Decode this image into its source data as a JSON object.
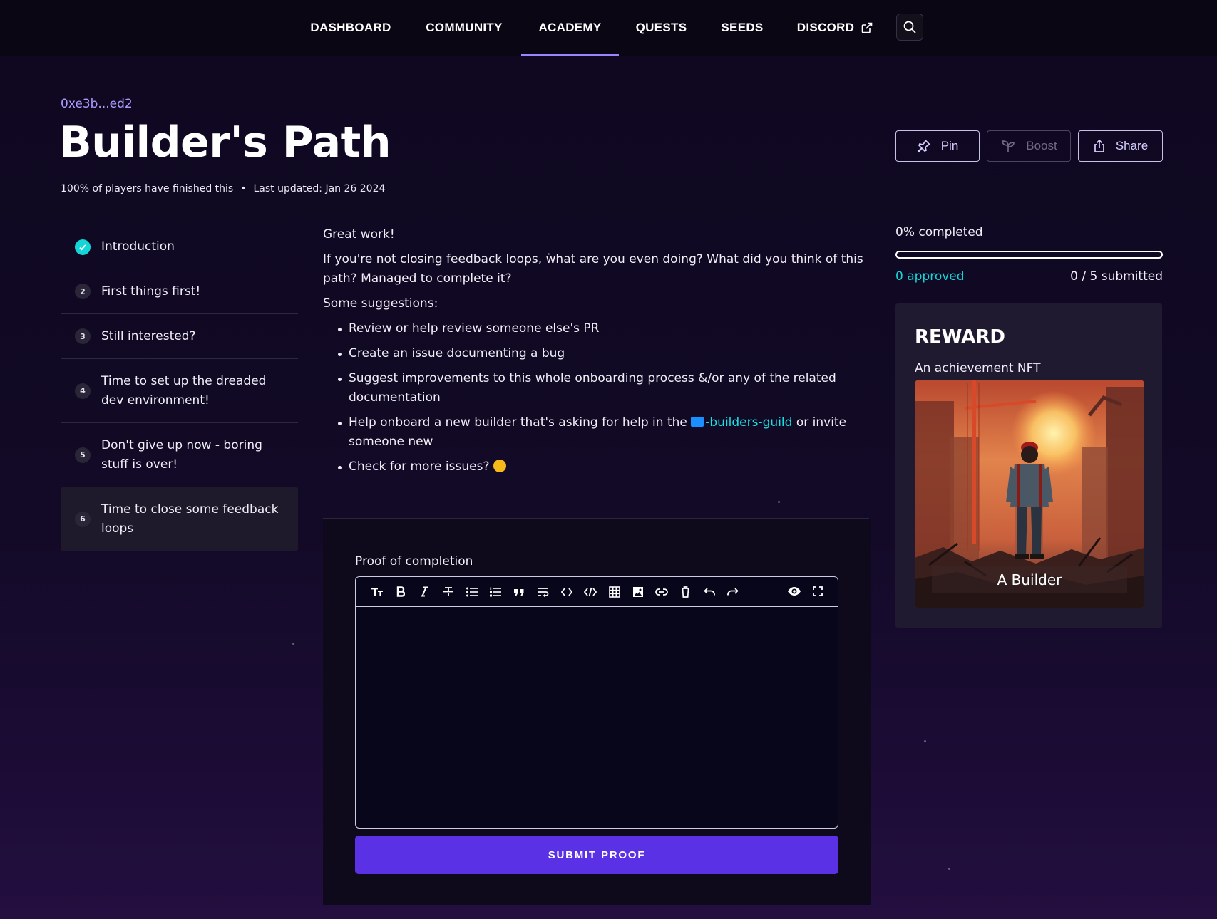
{
  "nav": {
    "items": [
      {
        "label": "DASHBOARD"
      },
      {
        "label": "COMMUNITY"
      },
      {
        "label": "ACADEMY"
      },
      {
        "label": "QUESTS"
      },
      {
        "label": "SEEDS"
      },
      {
        "label": "DISCORD"
      }
    ],
    "active": "ACADEMY",
    "search_icon": "search-icon"
  },
  "header": {
    "address": "0xe3b...ed2",
    "title": "Builder's Path",
    "finished": "100% of players have finished this",
    "separator": "•",
    "updated": "Last updated: Jan 26 2024"
  },
  "actions": {
    "pin": "Pin",
    "boost": "Boost",
    "share": "Share"
  },
  "steps": [
    {
      "num": "1",
      "label": "Introduction",
      "done": true
    },
    {
      "num": "2",
      "label": "First things first!"
    },
    {
      "num": "3",
      "label": "Still interested?"
    },
    {
      "num": "4",
      "label": "Time to set up the dreaded dev environment!"
    },
    {
      "num": "5",
      "label": "Don't give up now - boring stuff is over!"
    },
    {
      "num": "6",
      "label": "Time to close some feedback loops",
      "active": true
    }
  ],
  "content": {
    "p1": "Great work!",
    "p2": "If you're not closing feedback loops, what are you even doing? What did you think of this path? Managed to complete it?",
    "p3": "Some suggestions:",
    "bullets": {
      "b1": "Review or help review someone else's PR",
      "b2": "Create an issue documenting a bug",
      "b3": "Suggest improvements to this whole onboarding process &/or any of the related documentation",
      "b4_pre": "Help onboard a new builder that's asking for help in the ",
      "b4_channel": "-builders-guild",
      "b4_post": " or invite someone new",
      "b5": "Check for more issues? "
    }
  },
  "proof": {
    "label": "Proof of completion",
    "value": "",
    "submit": "SUBMIT PROOF",
    "toolbar": [
      "heading-icon",
      "bold-icon",
      "italic-icon",
      "strikethrough-icon",
      "bullet-list-icon",
      "ordered-list-icon",
      "quote-icon",
      "wrap-icon",
      "code-icon",
      "code-block-icon",
      "table-icon",
      "image-icon",
      "link-icon",
      "delete-icon",
      "undo-icon",
      "redo-icon"
    ],
    "toolbar_right": [
      "preview-icon",
      "fullscreen-icon"
    ]
  },
  "progress": {
    "completed_label": "0% completed",
    "fraction": 0,
    "approved": "0 approved",
    "submitted": "0 / 5 submitted"
  },
  "reward": {
    "title": "REWARD",
    "subtitle": "An achievement NFT",
    "nft_name": "A Builder"
  },
  "colors": {
    "accent": "#9b85ff",
    "cyan": "#14d6d6",
    "submit": "#5b31e6",
    "bg": "#0f0820"
  }
}
